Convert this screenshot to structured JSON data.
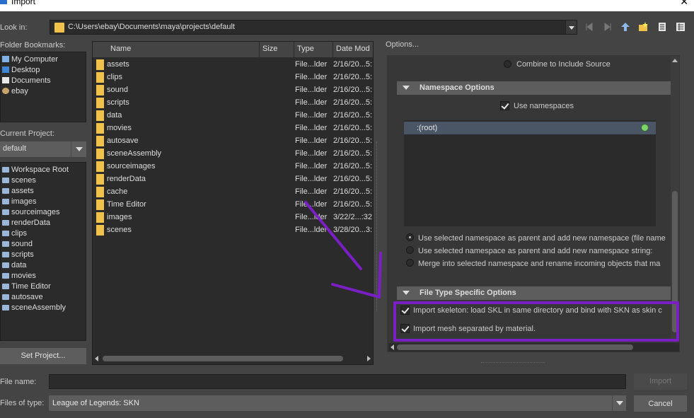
{
  "window": {
    "title": "Import"
  },
  "look_in": {
    "label": "Look in:",
    "path": "C:\\Users\\ebay\\Documents\\maya\\projects\\default"
  },
  "bookmarks": {
    "label": "Folder Bookmarks:",
    "items": [
      "My Computer",
      "Desktop",
      "Documents",
      "ebay"
    ]
  },
  "project": {
    "label": "Current Project:",
    "selected": "default",
    "workspace": [
      "Workspace Root",
      "scenes",
      "assets",
      "images",
      "sourceimages",
      "renderData",
      "clips",
      "sound",
      "scripts",
      "data",
      "movies",
      "Time Editor",
      "autosave",
      "sceneAssembly"
    ],
    "set_button": "Set Project..."
  },
  "files": {
    "columns": [
      "Name",
      "Size",
      "Type",
      "Date Mod"
    ],
    "rows": [
      {
        "name": "assets",
        "type": "File...lder",
        "date": "2/16/20...5:"
      },
      {
        "name": "clips",
        "type": "File...lder",
        "date": "2/16/20...5:"
      },
      {
        "name": "sound",
        "type": "File...lder",
        "date": "2/16/20...5:"
      },
      {
        "name": "scripts",
        "type": "File...lder",
        "date": "2/16/20...5:"
      },
      {
        "name": "data",
        "type": "File...lder",
        "date": "2/16/20...5:"
      },
      {
        "name": "movies",
        "type": "File...lder",
        "date": "2/16/20...5:"
      },
      {
        "name": "autosave",
        "type": "File...lder",
        "date": "2/16/20...5:"
      },
      {
        "name": "sceneAssembly",
        "type": "File...lder",
        "date": "2/16/20...5:"
      },
      {
        "name": "sourceimages",
        "type": "File...lder",
        "date": "2/16/20...5:"
      },
      {
        "name": "renderData",
        "type": "File...lder",
        "date": "2/16/20...5:"
      },
      {
        "name": "cache",
        "type": "File...lder",
        "date": "2/16/20...5:"
      },
      {
        "name": "Time Editor",
        "type": "File...lder",
        "date": "2/16/20...5:"
      },
      {
        "name": "images",
        "type": "File...lder",
        "date": "3/22/2...:32"
      },
      {
        "name": "scenes",
        "type": "File...lder",
        "date": "3/28/20...3:"
      }
    ]
  },
  "options": {
    "label": "Options...",
    "combine_label": "Combine to Include Source",
    "namespace": {
      "header": "Namespace Options",
      "use_label": "Use namespaces",
      "use_checked": true,
      "list_item": ":(root)",
      "radio": [
        {
          "label": "Use selected namespace as parent and add new namespace (file name",
          "checked": true
        },
        {
          "label": "Use selected namespace as parent and add new namespace string:",
          "checked": false
        },
        {
          "label": "Merge into selected namespace and rename incoming objects that ma",
          "checked": false
        }
      ]
    },
    "file_type": {
      "header": "File Type Specific Options",
      "skeleton_label": "Import skeleton: load SKL in same directory and bind with SKN as skin c",
      "skeleton_checked": true,
      "mesh_label": "Import mesh separated by material.",
      "mesh_checked": true
    }
  },
  "footer": {
    "file_name_label": "File name:",
    "file_name_value": "",
    "file_type_label": "Files of type:",
    "file_type_value": "League of Legends: SKN",
    "import_button": "Import",
    "cancel_button": "Cancel"
  },
  "annotation_color": "#7a1fc4"
}
